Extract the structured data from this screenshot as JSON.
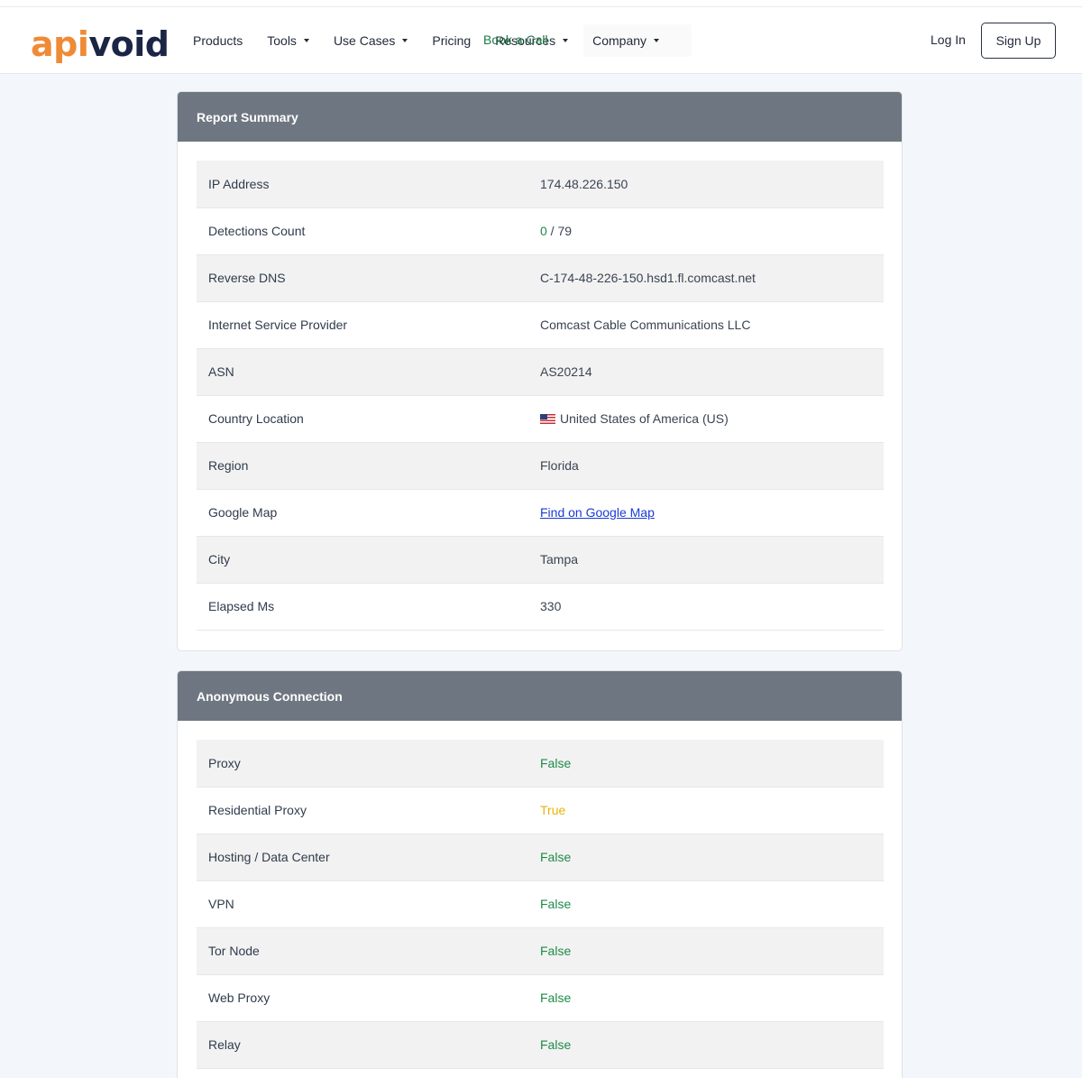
{
  "nav": {
    "logo_api": "api",
    "logo_void": "void",
    "items": [
      {
        "label": "Products",
        "caret": false
      },
      {
        "label": "Tools",
        "caret": true
      },
      {
        "label": "Use Cases",
        "caret": true
      },
      {
        "label": "Pricing",
        "caret": false
      },
      {
        "label": "Resources",
        "caret": true
      },
      {
        "label": "Company",
        "caret": true
      }
    ],
    "book_call": "Book a Call",
    "login": "Log In",
    "signup": "Sign Up"
  },
  "report_summary": {
    "title": "Report Summary",
    "rows": [
      {
        "key": "IP Address",
        "value": "174.48.226.150"
      },
      {
        "key": "Detections Count",
        "value_detections": "0",
        "value_total": " / 79"
      },
      {
        "key": "Reverse DNS",
        "value": "C-174-48-226-150.hsd1.fl.comcast.net"
      },
      {
        "key": "Internet Service Provider",
        "value": "Comcast Cable Communications LLC"
      },
      {
        "key": "ASN",
        "value": "AS20214"
      },
      {
        "key": "Country Location",
        "value": "United States of America (US)",
        "flag": "us-flag-icon"
      },
      {
        "key": "Region",
        "value": "Florida"
      },
      {
        "key": "Google Map",
        "value": "Find on Google Map"
      },
      {
        "key": "City",
        "value": "Tampa"
      },
      {
        "key": "Elapsed Ms",
        "value": "330"
      }
    ]
  },
  "anonymous_connection": {
    "title": "Anonymous Connection",
    "rows": [
      {
        "key": "Proxy",
        "value": "False"
      },
      {
        "key": "Residential Proxy",
        "value": "True"
      },
      {
        "key": "Hosting / Data Center",
        "value": "False"
      },
      {
        "key": "VPN",
        "value": "False"
      },
      {
        "key": "Tor Node",
        "value": "False"
      },
      {
        "key": "Web Proxy",
        "value": "False"
      },
      {
        "key": "Relay",
        "value": "False"
      }
    ]
  },
  "colors": {
    "false_color": "#1f8a47",
    "true_color": "#e8b40c",
    "header_bg": "#6e7781",
    "link_color": "#1a3bd6",
    "logo_orange": "#ef8a35",
    "logo_navy": "#1b2545"
  }
}
